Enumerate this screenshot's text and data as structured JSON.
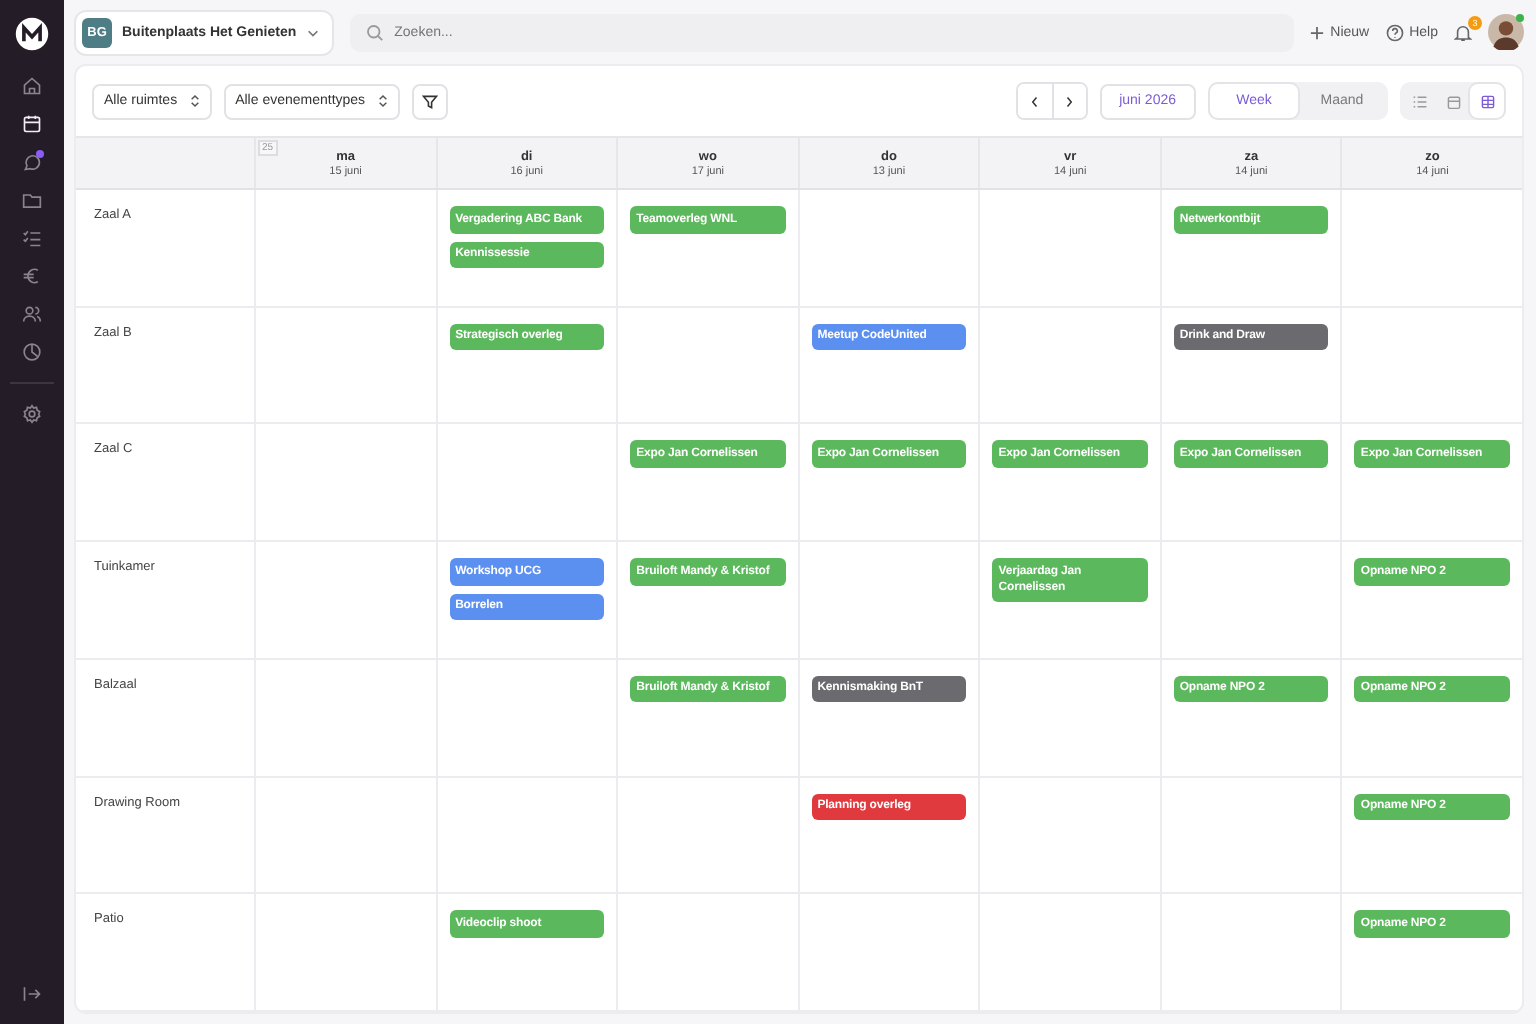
{
  "sidebar": {
    "items": [
      {
        "kind": "home",
        "selected": false,
        "badge": false
      },
      {
        "kind": "calendar",
        "selected": true,
        "badge": false
      },
      {
        "kind": "chat",
        "selected": false,
        "badge": true
      },
      {
        "kind": "folder",
        "selected": false,
        "badge": false
      },
      {
        "kind": "tasks",
        "selected": false,
        "badge": false
      },
      {
        "kind": "euro",
        "selected": false,
        "badge": false
      },
      {
        "kind": "people",
        "selected": false,
        "badge": false
      },
      {
        "kind": "chart",
        "selected": false,
        "badge": false
      },
      {
        "kind": "divider"
      },
      {
        "kind": "settings",
        "selected": false,
        "badge": false
      }
    ]
  },
  "header": {
    "org_initials": "BG",
    "org_name": "Buitenplaats Het Genieten",
    "search": {
      "placeholder": "Zoeken..."
    },
    "new_label": "Nieuw",
    "help_label": "Help",
    "notification_count": "3",
    "avatar_online": true
  },
  "toolbar": {
    "room_filter": "Alle ruimtes",
    "type_filter": "Alle evenementtypes",
    "period": "juni 2026",
    "view_tabs": [
      {
        "label": "Week",
        "selected": true
      },
      {
        "label": "Maand",
        "selected": false
      }
    ],
    "layout_buttons": [
      {
        "kind": "list",
        "selected": false
      },
      {
        "kind": "calendar",
        "selected": false
      },
      {
        "kind": "grid",
        "selected": true
      }
    ]
  },
  "grid": {
    "week_number": "25",
    "days": [
      {
        "name": "ma",
        "date": "15 juni"
      },
      {
        "name": "di",
        "date": "16 juni"
      },
      {
        "name": "wo",
        "date": "17 juni"
      },
      {
        "name": "do",
        "date": "13 juni"
      },
      {
        "name": "vr",
        "date": "14 juni"
      },
      {
        "name": "za",
        "date": "14 juni"
      },
      {
        "name": "zo",
        "date": "14 juni"
      }
    ],
    "rows": [
      {
        "room": "Zaal A",
        "cells": [
          {},
          {
            "events": [
              {
                "title": "Vergadering ABC Bank",
                "color": "#5cb85c"
              },
              {
                "title": "Kennissessie",
                "color": "#5cb85c"
              }
            ]
          },
          {
            "events": [
              {
                "title": "Teamoverleg WNL",
                "color": "#5cb85c"
              }
            ]
          },
          {},
          {},
          {
            "events": [
              {
                "title": "Netwerkontbijt",
                "color": "#5cb85c"
              }
            ]
          },
          {}
        ]
      },
      {
        "room": "Zaal B",
        "cells": [
          {},
          {
            "events": [
              {
                "title": "Strategisch overleg",
                "color": "#5cb85c"
              }
            ]
          },
          {},
          {
            "events": [
              {
                "title": "Meetup CodeUnited",
                "color": "#5b8ff0"
              }
            ]
          },
          {},
          {
            "events": [
              {
                "title": "Drink and Draw",
                "color": "#6b6a6f"
              }
            ]
          },
          {}
        ]
      },
      {
        "room": "Zaal C",
        "cells": [
          {},
          {},
          {
            "events": [
              {
                "title": "Expo Jan Cornelissen",
                "color": "#5cb85c"
              }
            ]
          },
          {
            "events": [
              {
                "title": "Expo Jan Cornelissen",
                "color": "#5cb85c"
              }
            ]
          },
          {
            "events": [
              {
                "title": "Expo Jan Cornelissen",
                "color": "#5cb85c"
              }
            ]
          },
          {
            "events": [
              {
                "title": "Expo Jan Cornelissen",
                "color": "#5cb85c"
              }
            ]
          },
          {
            "events": [
              {
                "title": "Expo Jan Cornelissen",
                "color": "#5cb85c"
              }
            ]
          }
        ]
      },
      {
        "room": "Tuinkamer",
        "cells": [
          {},
          {
            "events": [
              {
                "title": "Workshop UCG",
                "color": "#5b8ff0"
              },
              {
                "title": "Borrelen",
                "color": "#5b8ff0"
              }
            ]
          },
          {
            "events": [
              {
                "title": "Bruiloft Mandy & Kristof",
                "color": "#5cb85c"
              }
            ]
          },
          {},
          {
            "events": [
              {
                "title": "Verjaardag Jan Cornelissen",
                "color": "#5cb85c"
              }
            ]
          },
          {},
          {
            "events": [
              {
                "title": "Opname NPO 2",
                "color": "#5cb85c"
              }
            ]
          }
        ]
      },
      {
        "room": "Balzaal",
        "cells": [
          {},
          {},
          {
            "events": [
              {
                "title": "Bruiloft Mandy & Kristof",
                "color": "#5cb85c"
              }
            ]
          },
          {
            "events": [
              {
                "title": "Kennismaking BnT",
                "color": "#6b6a6f"
              }
            ]
          },
          {},
          {
            "events": [
              {
                "title": "Opname NPO 2",
                "color": "#5cb85c"
              }
            ]
          },
          {
            "events": [
              {
                "title": "Opname NPO 2",
                "color": "#5cb85c"
              }
            ]
          }
        ]
      },
      {
        "room": "Drawing Room",
        "cells": [
          {},
          {},
          {},
          {
            "events": [
              {
                "title": "Planning overleg",
                "color": "#e0393e"
              }
            ]
          },
          {},
          {},
          {
            "events": [
              {
                "title": "Opname NPO 2",
                "color": "#5cb85c"
              }
            ]
          }
        ]
      },
      {
        "room": "Patio",
        "cells": [
          {},
          {
            "events": [
              {
                "title": "Videoclip shoot",
                "color": "#5cb85c"
              }
            ]
          },
          {},
          {},
          {},
          {},
          {
            "events": [
              {
                "title": "Opname NPO 2",
                "color": "#5cb85c"
              }
            ]
          }
        ]
      }
    ]
  }
}
